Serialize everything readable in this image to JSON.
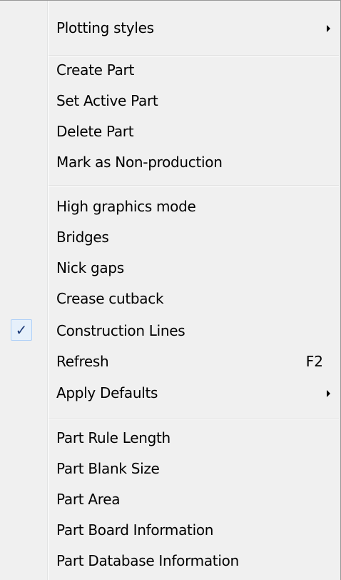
{
  "menu": {
    "plotting_styles": "Plotting styles",
    "create_part": "Create Part",
    "set_active_part": "Set Active Part",
    "delete_part": "Delete Part",
    "mark_non_production": "Mark as Non-production",
    "high_graphics_mode": "High graphics mode",
    "bridges": "Bridges",
    "nick_gaps": "Nick gaps",
    "crease_cutback": "Crease cutback",
    "construction_lines": "Construction Lines",
    "construction_lines_check": "✓",
    "refresh": "Refresh",
    "refresh_shortcut": "F2",
    "apply_defaults": "Apply Defaults",
    "part_rule_length": "Part Rule Length",
    "part_blank_size": "Part Blank Size",
    "part_area": "Part Area",
    "part_board_information": "Part Board Information",
    "part_database_information": "Part Database Information"
  },
  "state": {
    "construction_lines_checked": true
  },
  "colors": {
    "menu_background": "#f0f0f0",
    "check_highlight": "#e6f0fb",
    "check_border": "#aecff7",
    "check_mark": "#1c3a78"
  },
  "icons": {
    "submenu_arrow": "submenu-arrow-icon",
    "check": "checkmark-icon"
  }
}
